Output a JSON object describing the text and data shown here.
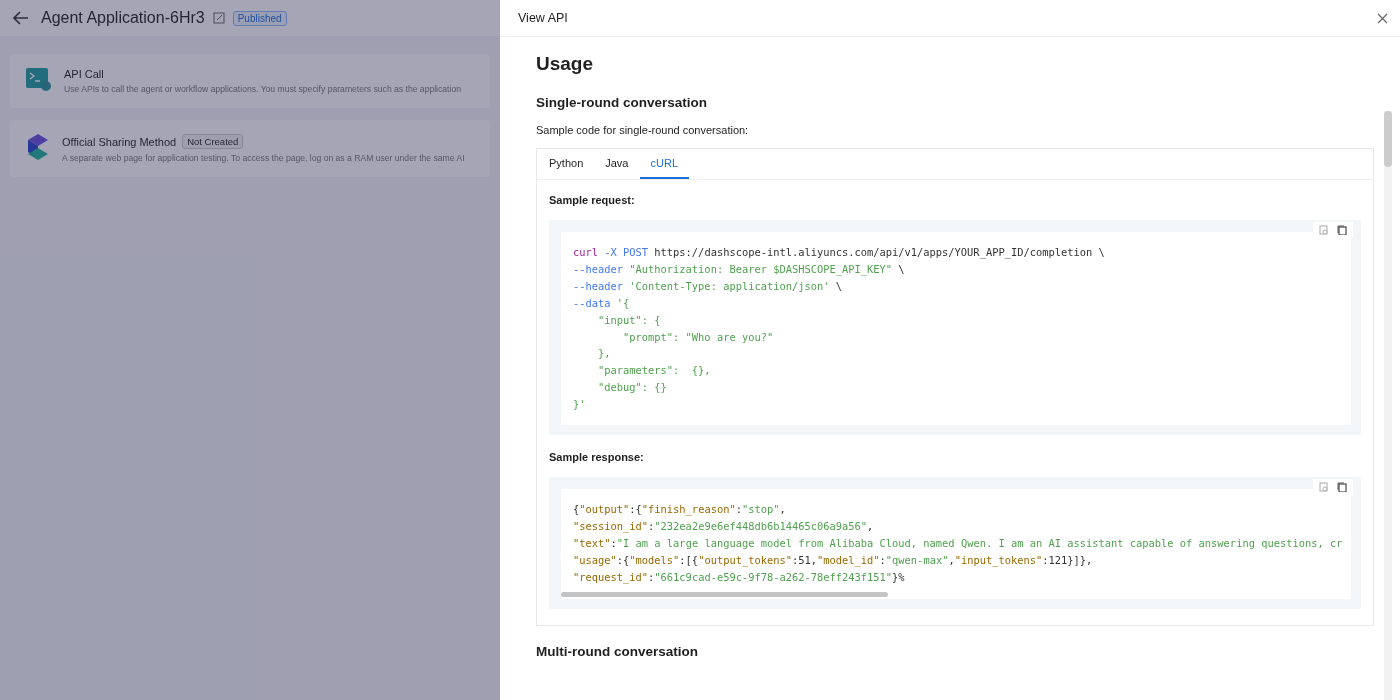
{
  "page": {
    "title": "Agent Application-6Hr3",
    "status": "Published",
    "methods": [
      {
        "kind": "api",
        "title": "API Call",
        "desc": "Use APIs to call the agent or workflow applications. You must specify parameters such as the application"
      },
      {
        "kind": "share",
        "title": "Official Sharing Method",
        "badge": "Not Created",
        "desc": "A separate web page for application testing. To access the page, log on as a RAM user under the same AI"
      }
    ]
  },
  "drawer": {
    "title": "View API",
    "heading": "Usage",
    "section": "Single-round conversation",
    "intro": "Sample code for single-round conversation:",
    "tabs": [
      {
        "label": "Python",
        "selected": false
      },
      {
        "label": "Java",
        "selected": false
      },
      {
        "label": "cURL",
        "selected": true
      }
    ],
    "request_label": "Sample request:",
    "request": [
      [
        {
          "t": "curl",
          "kind": "cmd"
        },
        {
          "t": " -X POST",
          "kind": "flag"
        },
        {
          "t": " https://dashscope-intl.aliyuncs.com/api/v1/apps/YOUR_APP_ID/completion \\",
          "kind": "plain"
        }
      ],
      [
        {
          "t": "--header",
          "kind": "flag"
        },
        {
          "t": " \"Authorization: Bearer $DASHSCOPE_API_KEY\"",
          "kind": "str"
        },
        {
          "t": " \\",
          "kind": "plain"
        }
      ],
      [
        {
          "t": "--header",
          "kind": "flag"
        },
        {
          "t": " 'Content-Type: application/json'",
          "kind": "str"
        },
        {
          "t": " \\",
          "kind": "plain"
        }
      ],
      [
        {
          "t": "--data",
          "kind": "flag"
        },
        {
          "t": " '{",
          "kind": "str"
        }
      ],
      [
        {
          "t": "    \"input\": {",
          "kind": "str"
        }
      ],
      [
        {
          "t": "        \"prompt\": \"Who are you?\"",
          "kind": "str"
        }
      ],
      [
        {
          "t": "    },",
          "kind": "str"
        }
      ],
      [
        {
          "t": "    \"parameters\":  {},",
          "kind": "str"
        }
      ],
      [
        {
          "t": "    \"debug\": {}",
          "kind": "str"
        }
      ],
      [
        {
          "t": "}'",
          "kind": "str"
        }
      ]
    ],
    "response_label": "Sample response:",
    "response": [
      [
        {
          "t": "{",
          "kind": "plain"
        },
        {
          "t": "\"output\"",
          "kind": "key"
        },
        {
          "t": ":{",
          "kind": "plain"
        },
        {
          "t": "\"finish_reason\"",
          "kind": "key"
        },
        {
          "t": ":",
          "kind": "plain"
        },
        {
          "t": "\"stop\"",
          "kind": "str"
        },
        {
          "t": ",",
          "kind": "plain"
        }
      ],
      [
        {
          "t": "\"session_id\"",
          "kind": "key"
        },
        {
          "t": ":",
          "kind": "plain"
        },
        {
          "t": "\"232ea2e9e6ef448db6b14465c06a9a56\"",
          "kind": "str"
        },
        {
          "t": ",",
          "kind": "plain"
        }
      ],
      [
        {
          "t": "\"text\"",
          "kind": "key"
        },
        {
          "t": ":",
          "kind": "plain"
        },
        {
          "t": "\"I am a large language model from Alibaba Cloud, named Qwen. I am an AI assistant capable of answering questions, cr",
          "kind": "str"
        }
      ],
      [
        {
          "t": "\"usage\"",
          "kind": "key"
        },
        {
          "t": ":{",
          "kind": "plain"
        },
        {
          "t": "\"models\"",
          "kind": "key"
        },
        {
          "t": ":[{",
          "kind": "plain"
        },
        {
          "t": "\"output_tokens\"",
          "kind": "key"
        },
        {
          "t": ":51,",
          "kind": "plain"
        },
        {
          "t": "\"model_id\"",
          "kind": "key"
        },
        {
          "t": ":",
          "kind": "plain"
        },
        {
          "t": "\"qwen-max\"",
          "kind": "str"
        },
        {
          "t": ",",
          "kind": "plain"
        },
        {
          "t": "\"input_tokens\"",
          "kind": "key"
        },
        {
          "t": ":121}]},",
          "kind": "plain"
        }
      ],
      [
        {
          "t": "\"request_id\"",
          "kind": "key"
        },
        {
          "t": ":",
          "kind": "plain"
        },
        {
          "t": "\"661c9cad-e59c-9f78-a262-78eff243f151\"",
          "kind": "str"
        },
        {
          "t": "}%",
          "kind": "plain"
        }
      ]
    ],
    "next_section": "Multi-round conversation"
  }
}
